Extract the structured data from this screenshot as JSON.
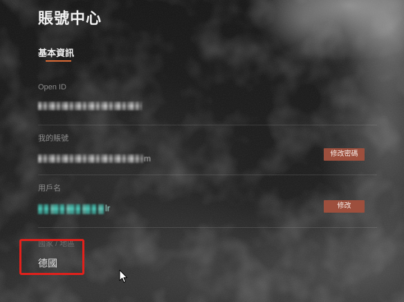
{
  "page": {
    "title": "賬號中心"
  },
  "tabs": [
    {
      "label": "基本資訊",
      "active": true
    }
  ],
  "fields": {
    "open_id": {
      "label": "Open ID",
      "blurred": true
    },
    "account": {
      "label": "我的賬號",
      "blurred": true,
      "value_tail": "m",
      "button_label": "修改密碼"
    },
    "username": {
      "label": "用戶名",
      "blurred": true,
      "value_tail": "lr",
      "button_label": "修改"
    },
    "region": {
      "label": "國家 / 地區",
      "value": "德國"
    }
  },
  "colors": {
    "accent": "#db6b36",
    "button": "#9d4f3d",
    "username_value": "#4fcfbf",
    "highlight_box": "#e3201b"
  },
  "icons": {
    "cursor": "mouse-pointer-icon"
  }
}
